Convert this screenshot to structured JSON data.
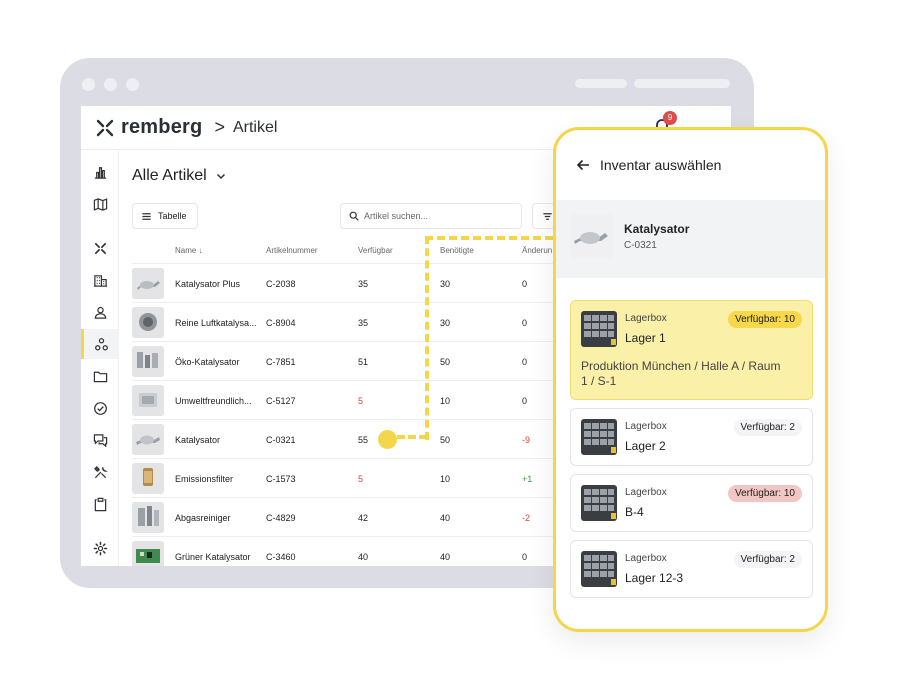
{
  "app": {
    "logo_text": "remberg",
    "breadcrumb_sep": ">",
    "breadcrumb": "Artikel",
    "notification_count": "9",
    "colors": {
      "accent": "#f3d64a",
      "danger": "#d9453a",
      "success": "#3a9d4a"
    }
  },
  "sidebar": {
    "items": [
      {
        "icon": "bar-chart-icon"
      },
      {
        "icon": "map-icon"
      },
      {
        "icon": "remberg-logo-icon"
      },
      {
        "icon": "building-icon"
      },
      {
        "icon": "user-icon"
      },
      {
        "icon": "parts-icon",
        "active": true
      },
      {
        "icon": "folder-icon"
      },
      {
        "icon": "check-circle-icon"
      },
      {
        "icon": "chat-icon"
      },
      {
        "icon": "tools-icon"
      },
      {
        "icon": "clipboard-icon"
      },
      {
        "icon": "settings-icon"
      }
    ]
  },
  "main": {
    "title": "Alle Artikel",
    "view_button": "Tabelle",
    "search_placeholder": "Artikel suchen...",
    "columns": [
      "Name ↓",
      "Artikelnummer",
      "Verfügbar",
      "Benötigte",
      "Änderun"
    ],
    "rows": [
      {
        "name": "Katalysator Plus",
        "number": "C-2038",
        "available": "35",
        "needed": "30",
        "change": "0",
        "avail_status": "normal",
        "change_status": "normal"
      },
      {
        "name": "Reine Luftkatalysa...",
        "number": "C-8904",
        "available": "35",
        "needed": "30",
        "change": "0",
        "avail_status": "normal",
        "change_status": "normal"
      },
      {
        "name": "Öko-Katalysator",
        "number": "C-7851",
        "available": "51",
        "needed": "50",
        "change": "0",
        "avail_status": "normal",
        "change_status": "normal"
      },
      {
        "name": "Umweltfreundlich...",
        "number": "C-5127",
        "available": "5",
        "needed": "10",
        "change": "0",
        "avail_status": "red",
        "change_status": "normal"
      },
      {
        "name": "Katalysator",
        "number": "C-0321",
        "available": "55",
        "needed": "50",
        "change": "-9",
        "avail_status": "normal",
        "change_status": "red"
      },
      {
        "name": "Emissionsfilter",
        "number": "C-1573",
        "available": "5",
        "needed": "10",
        "change": "+1",
        "avail_status": "red",
        "change_status": "green"
      },
      {
        "name": "Abgasreiniger",
        "number": "C-4829",
        "available": "42",
        "needed": "40",
        "change": "-2",
        "avail_status": "normal",
        "change_status": "red"
      },
      {
        "name": "Grüner Katalysator",
        "number": "C-3460",
        "available": "40",
        "needed": "40",
        "change": "0",
        "avail_status": "normal",
        "change_status": "normal"
      }
    ]
  },
  "panel": {
    "title": "Inventar auswählen",
    "item": {
      "name": "Katalysator",
      "number": "C-0321"
    },
    "locations": [
      {
        "type": "Lagerbox",
        "name": "Lager 1",
        "badge": "Verfügbar: 10",
        "badge_style": "yellow",
        "path": "Produktion München / Halle A / Raum 1 / S-1",
        "selected": true
      },
      {
        "type": "Lagerbox",
        "name": "Lager 2",
        "badge": "Verfügbar: 2",
        "badge_style": "gray",
        "selected": false
      },
      {
        "type": "Lagerbox",
        "name": "B-4",
        "badge": "Verfügbar: 10",
        "badge_style": "pink",
        "selected": false
      },
      {
        "type": "Lagerbox",
        "name": "Lager 12-3",
        "badge": "Verfügbar: 2",
        "badge_style": "gray",
        "selected": false
      }
    ]
  }
}
